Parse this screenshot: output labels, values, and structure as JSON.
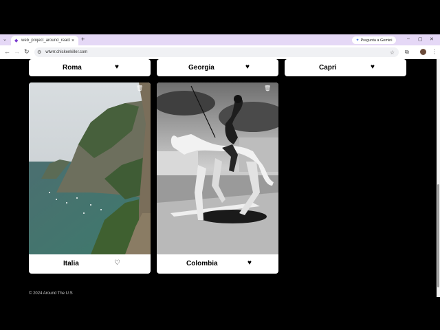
{
  "browser": {
    "tab_title": "web_project_around_react",
    "tab_close": "×",
    "new_tab": "+",
    "gemini_label": "Pregunta a Gemini",
    "url": "wtwrr.chickenkiller.com"
  },
  "cards": [
    {
      "title": "Roma",
      "liked": true
    },
    {
      "title": "Georgia",
      "liked": true
    },
    {
      "title": "Capri",
      "liked": true
    },
    {
      "title": "Italia",
      "liked": false
    },
    {
      "title": "Colombia",
      "liked": true
    }
  ],
  "footer": {
    "text": "© 2024 Around The U.S"
  },
  "colors": {
    "titlebar": "#e5d8f6",
    "page_background": "#000000",
    "card_background": "#ffffff"
  },
  "icons": {
    "heart_filled": "♥",
    "heart_empty": "♡",
    "trash": "trash-icon"
  }
}
